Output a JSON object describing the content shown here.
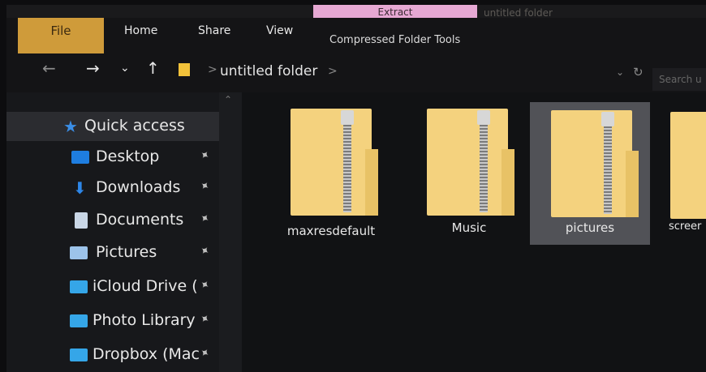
{
  "window": {
    "title": "untitled folder",
    "context_tab": "Extract"
  },
  "ribbon": {
    "tabs": [
      "File",
      "Home",
      "Share",
      "View"
    ],
    "contextual_tools": "Compressed Folder Tools"
  },
  "address": {
    "path_segment": "untitled folder",
    "separator": ">",
    "search_placeholder": "Search u"
  },
  "nav_icons": {
    "back": "arrow-left-icon",
    "forward": "arrow-right-icon",
    "recent": "chevron-down-icon",
    "up": "arrow-up-icon",
    "refresh": "refresh-icon"
  },
  "sidebar": {
    "items": [
      {
        "label": "Quick access",
        "icon": "star-icon",
        "pinned": false,
        "color": "#3a8ee6"
      },
      {
        "label": "Desktop",
        "icon": "desktop-icon",
        "pinned": true,
        "color": "#1e7de0"
      },
      {
        "label": "Downloads",
        "icon": "download-icon",
        "pinned": true,
        "color": "#2d86e8"
      },
      {
        "label": "Documents",
        "icon": "documents-icon",
        "pinned": true,
        "color": "#c9d6e6"
      },
      {
        "label": "Pictures",
        "icon": "pictures-icon",
        "pinned": true,
        "color": "#9cc3ea"
      },
      {
        "label": "iCloud Drive (",
        "icon": "folder-icon",
        "pinned": true,
        "color": "#35a6e8"
      },
      {
        "label": "Photo Library",
        "icon": "folder-icon",
        "pinned": true,
        "color": "#35a6e8"
      },
      {
        "label": "Dropbox (Mac",
        "icon": "folder-icon",
        "pinned": true,
        "color": "#35a6e8"
      }
    ]
  },
  "files": [
    {
      "name": "maxresdefault",
      "icon": "zip-folder-icon",
      "selected": false
    },
    {
      "name": "Music",
      "icon": "zip-folder-icon",
      "selected": false
    },
    {
      "name": "pictures",
      "icon": "zip-folder-icon",
      "selected": true
    },
    {
      "name": "screer",
      "icon": "zip-folder-icon",
      "selected": false
    }
  ],
  "colors": {
    "file_tab": "#cf9b3a",
    "extract_tab": "#e6a8d3",
    "folder_yellow": "#f4d27e",
    "selection": "#515257"
  }
}
